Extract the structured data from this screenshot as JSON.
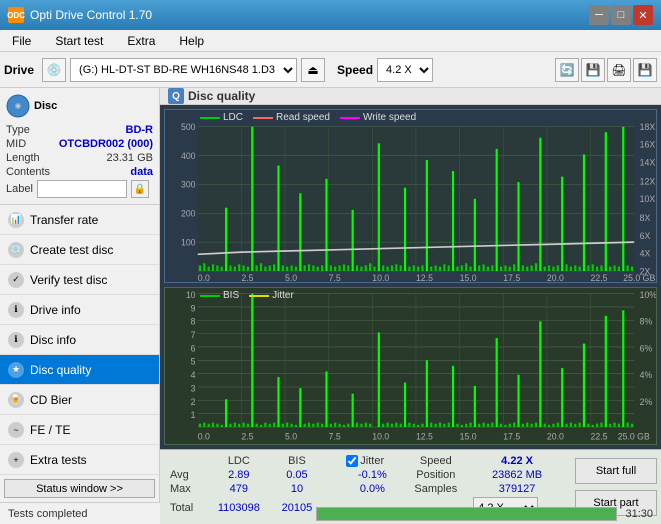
{
  "app": {
    "title": "Opti Drive Control 1.70",
    "icon": "ODC"
  },
  "titlebar": {
    "minimize": "─",
    "maximize": "□",
    "close": "✕"
  },
  "menu": {
    "items": [
      "File",
      "Start test",
      "Extra",
      "Help"
    ]
  },
  "toolbar": {
    "drive_label": "Drive",
    "drive_value": "(G:) HL-DT-ST BD-RE  WH16NS48 1.D3",
    "speed_label": "Speed",
    "speed_value": "4.2 X"
  },
  "disc": {
    "header": "Disc",
    "type_label": "Type",
    "type_value": "BD-R",
    "mid_label": "MID",
    "mid_value": "OTCBDR002 (000)",
    "length_label": "Length",
    "length_value": "23.31 GB",
    "contents_label": "Contents",
    "contents_value": "data",
    "label_label": "Label",
    "label_value": ""
  },
  "nav": {
    "items": [
      {
        "id": "transfer-rate",
        "label": "Transfer rate",
        "active": false
      },
      {
        "id": "create-test-disc",
        "label": "Create test disc",
        "active": false
      },
      {
        "id": "verify-test-disc",
        "label": "Verify test disc",
        "active": false
      },
      {
        "id": "drive-info",
        "label": "Drive info",
        "active": false
      },
      {
        "id": "disc-info",
        "label": "Disc info",
        "active": false
      },
      {
        "id": "disc-quality",
        "label": "Disc quality",
        "active": true
      },
      {
        "id": "cd-bier",
        "label": "CD Bier",
        "active": false
      },
      {
        "id": "fe-te",
        "label": "FE / TE",
        "active": false
      },
      {
        "id": "extra-tests",
        "label": "Extra tests",
        "active": false
      }
    ],
    "status_button": "Status window >>"
  },
  "chart": {
    "title": "Disc quality",
    "top": {
      "legend": [
        {
          "label": "LDC",
          "color": "#00cc00"
        },
        {
          "label": "Read speed",
          "color": "#ff6666"
        },
        {
          "label": "Write speed",
          "color": "#ff00ff"
        }
      ],
      "y_max": 500,
      "y_min": 0,
      "y_right_max": 18,
      "x_labels": [
        "0.0",
        "2.5",
        "5.0",
        "7.5",
        "10.0",
        "12.5",
        "15.0",
        "17.5",
        "20.0",
        "22.5",
        "25.0 GB"
      ],
      "y_labels": [
        "500",
        "400",
        "300",
        "200",
        "100"
      ]
    },
    "bottom": {
      "legend": [
        {
          "label": "BIS",
          "color": "#00cc00"
        },
        {
          "label": "Jitter",
          "color": "#dddd00"
        }
      ],
      "y_max": 10,
      "y_min": 0,
      "x_labels": [
        "0.0",
        "2.5",
        "5.0",
        "7.5",
        "10.0",
        "12.5",
        "15.0",
        "17.5",
        "20.0",
        "22.5",
        "25.0 GB"
      ],
      "y_labels": [
        "10",
        "9",
        "8",
        "7",
        "6",
        "5",
        "4",
        "3",
        "2",
        "1"
      ]
    }
  },
  "stats": {
    "headers": [
      "",
      "LDC",
      "BIS",
      "",
      "Jitter",
      "Speed",
      ""
    ],
    "avg_label": "Avg",
    "avg_ldc": "2.89",
    "avg_bis": "0.05",
    "avg_jitter": "-0.1%",
    "max_label": "Max",
    "max_ldc": "479",
    "max_bis": "10",
    "max_jitter": "0.0%",
    "total_label": "Total",
    "total_ldc": "1103098",
    "total_bis": "20105",
    "jitter_checked": true,
    "jitter_label": "Jitter",
    "speed_label": "Speed",
    "speed_value": "4.22 X",
    "speed_select": "4.2 X",
    "position_label": "Position",
    "position_value": "23862 MB",
    "samples_label": "Samples",
    "samples_value": "379127",
    "start_full": "Start full",
    "start_part": "Start part"
  },
  "statusbar": {
    "text": "Tests completed",
    "progress": 100,
    "time": "31:30"
  },
  "colors": {
    "accent_blue": "#0078d7",
    "grid_bg": "#2d3a4a",
    "ldc_color": "#00cc00",
    "bis_color": "#00cc00",
    "read_speed_color": "#ffffff",
    "jitter_color": "#dddd00",
    "spike_color": "#00ff00"
  }
}
